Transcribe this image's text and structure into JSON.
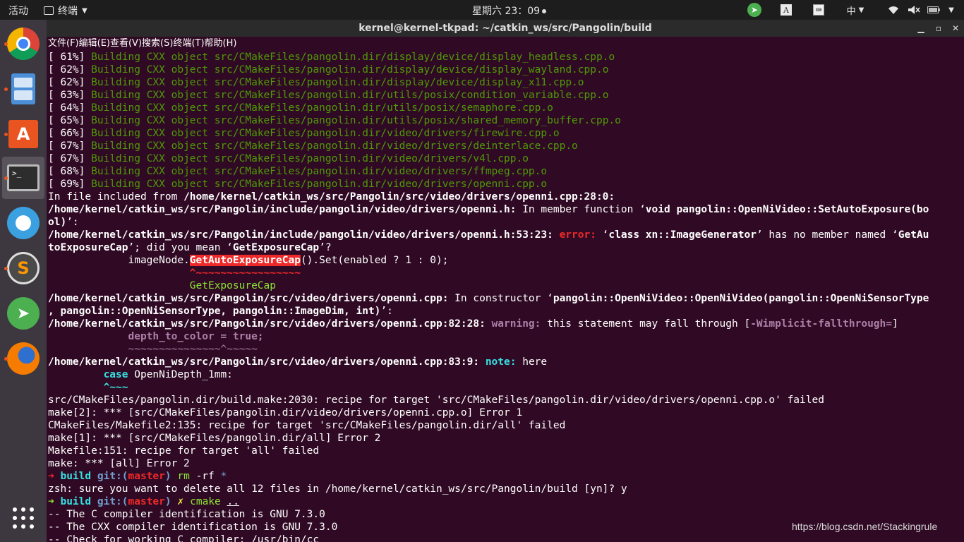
{
  "topbar": {
    "activities": "活动",
    "app_name": "终端",
    "clock": "星期六 23：09",
    "ime": "中",
    "tray_a": "A"
  },
  "window": {
    "title": "kernel@kernel-tkpad: ~/catkin_ws/src/Pangolin/build",
    "menu": [
      "文件(F)",
      "编辑(E)",
      "查看(V)",
      "搜索(S)",
      "终端(T)",
      "帮助(H)"
    ]
  },
  "dock": {
    "items": [
      "chrome-icon",
      "files-cabinet-icon",
      "software-center-icon",
      "terminal-icon",
      "settings-gear-icon",
      "sublime-text-icon",
      "telegram-icon",
      "firefox-icon",
      "show-apps-icon"
    ]
  },
  "terminal": {
    "build_lines": [
      {
        "pct": "[ 61%]",
        "text": "Building CXX object src/CMakeFiles/pangolin.dir/display/device/display_headless.cpp.o"
      },
      {
        "pct": "[ 62%]",
        "text": "Building CXX object src/CMakeFiles/pangolin.dir/display/device/display_wayland.cpp.o"
      },
      {
        "pct": "[ 62%]",
        "text": "Building CXX object src/CMakeFiles/pangolin.dir/display/device/display_x11.cpp.o"
      },
      {
        "pct": "[ 63%]",
        "text": "Building CXX object src/CMakeFiles/pangolin.dir/utils/posix/condition_variable.cpp.o"
      },
      {
        "pct": "[ 64%]",
        "text": "Building CXX object src/CMakeFiles/pangolin.dir/utils/posix/semaphore.cpp.o"
      },
      {
        "pct": "[ 65%]",
        "text": "Building CXX object src/CMakeFiles/pangolin.dir/utils/posix/shared_memory_buffer.cpp.o"
      },
      {
        "pct": "[ 66%]",
        "text": "Building CXX object src/CMakeFiles/pangolin.dir/video/drivers/firewire.cpp.o"
      },
      {
        "pct": "[ 67%]",
        "text": "Building CXX object src/CMakeFiles/pangolin.dir/video/drivers/deinterlace.cpp.o"
      },
      {
        "pct": "[ 67%]",
        "text": "Building CXX object src/CMakeFiles/pangolin.dir/video/drivers/v4l.cpp.o"
      },
      {
        "pct": "[ 68%]",
        "text": "Building CXX object src/CMakeFiles/pangolin.dir/video/drivers/ffmpeg.cpp.o"
      },
      {
        "pct": "[ 69%]",
        "text": "Building CXX object src/CMakeFiles/pangolin.dir/video/drivers/openni.cpp.o"
      }
    ],
    "incl_prefix": "In file included from ",
    "incl_path": "/home/kernel/catkin_ws/src/Pangolin/src/video/drivers/openni.cpp:28:0",
    "incl_suffix": ":",
    "hdr_path": "/home/kernel/catkin_ws/src/Pangolin/include/pangolin/video/drivers/openni.h:",
    "hdr_mid": " In member function ‘",
    "hdr_func": "void pangolin::OpenNiVideo::SetAutoExposure(bo",
    "hdr_func_end": "ol)",
    "hdr_func_close": "’:",
    "err_path": "/home/kernel/catkin_ws/src/Pangolin/include/pangolin/video/drivers/openni.h:53:23:",
    "err_label": " error:",
    "err_q1": " ‘",
    "err_class": "class xn::ImageGenerator",
    "err_mid": "’ has no member named ‘",
    "err_member_a": "GetAu",
    "err_member_b": "toExposureCap",
    "err_mean": "’; did you mean ‘",
    "err_suggest": "GetExposureCap",
    "err_end": "’?",
    "code1_pre": "             imageNode.",
    "code1_hl": "GetAutoExposureCap",
    "code1_post": "().Set(enabled ? 1 : 0);",
    "tilde1": "                       ^~~~~~~~~~~~~~~~~~",
    "fix1": "                       GetExposureCap",
    "ctor_path": "/home/kernel/catkin_ws/src/Pangolin/src/video/drivers/openni.cpp:",
    "ctor_mid": " In constructor ‘",
    "ctor_sig": "pangolin::OpenNiVideo::OpenNiVideo(pangolin::OpenNiSensorType",
    "ctor_sig2": ", pangolin::OpenNiSensorType, pangolin::ImageDim, int)",
    "ctor_end": "’:",
    "warn_path": "/home/kernel/catkin_ws/src/Pangolin/src/video/drivers/openni.cpp:82:28:",
    "warn_label": " warning:",
    "warn_text": " this statement may fall through [",
    "warn_flag": "-Wimplicit-fallthrough=",
    "warn_close": "]",
    "code2": "             depth_to_color = true;",
    "tilde2": "             ~~~~~~~~~~~~~~~^~~~~~",
    "note_path": "/home/kernel/catkin_ws/src/Pangolin/src/video/drivers/openni.cpp:83:9:",
    "note_label": " note:",
    "note_text": " here",
    "code3_pre": "         ",
    "code3_kw": "case",
    "code3_rest": " OpenNiDepth_1mm:",
    "caret3": "         ^~~~",
    "make_lines": [
      "src/CMakeFiles/pangolin.dir/build.make:2030: recipe for target 'src/CMakeFiles/pangolin.dir/video/drivers/openni.cpp.o' failed",
      "make[2]: *** [src/CMakeFiles/pangolin.dir/video/drivers/openni.cpp.o] Error 1",
      "CMakeFiles/Makefile2:135: recipe for target 'src/CMakeFiles/pangolin.dir/all' failed",
      "make[1]: *** [src/CMakeFiles/pangolin.dir/all] Error 2",
      "Makefile:151: recipe for target 'all' failed",
      "make: *** [all] Error 2"
    ],
    "prompt_arrow": "➜",
    "prompt_dir": "build",
    "prompt_git": "git:(",
    "prompt_branch": "master",
    "prompt_git_close": ")",
    "cmd1": "rm",
    "cmd1_args": " -rf ",
    "cmd1_glob": "*",
    "zsh_confirm": "zsh: sure you want to delete all 12 files in /home/kernel/catkin_ws/src/Pangolin/build [yn]? y",
    "dirty_mark": "✗",
    "cmd2": "cmake",
    "cmd2_arg": "..",
    "out_lines": [
      "-- The C compiler identification is GNU 7.3.0",
      "-- The CXX compiler identification is GNU 7.3.0",
      "-- Check for working C compiler: /usr/bin/cc"
    ]
  },
  "watermark": "https://blog.csdn.net/Stackingrule"
}
